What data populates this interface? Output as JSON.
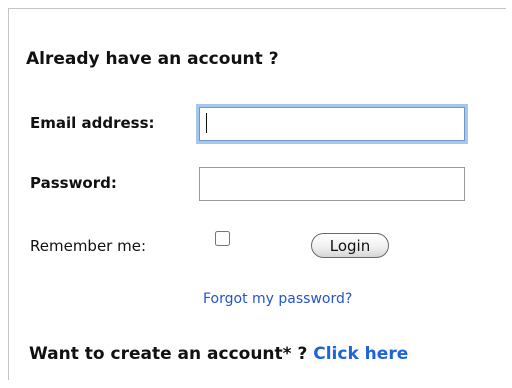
{
  "login_form": {
    "heading": "Already have an account ?",
    "email": {
      "label": "Email address:",
      "value": "",
      "placeholder": ""
    },
    "password": {
      "label": "Password:",
      "value": "",
      "placeholder": ""
    },
    "remember": {
      "label": "Remember me:",
      "checked": false
    },
    "login_button": "Login",
    "forgot_link": "Forgot my password?"
  },
  "signup": {
    "text": "Want to create an account* ? ",
    "link": "Click here"
  },
  "colors": {
    "link": "#1f63d8",
    "focus_ring": "#a6c8ef",
    "panel_border": "#c4c4c4"
  }
}
